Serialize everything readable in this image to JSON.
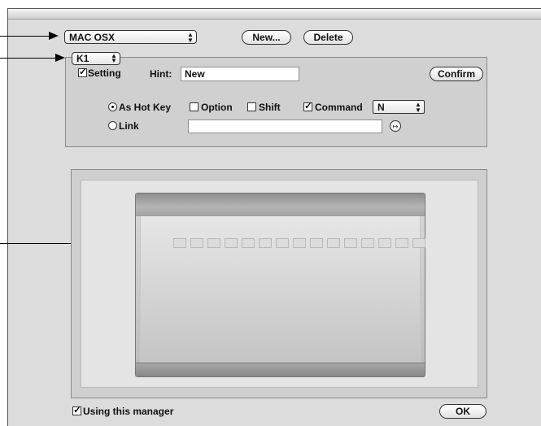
{
  "profile_select": {
    "value": "MAC OSX"
  },
  "toolbar": {
    "new_label": "New...",
    "delete_label": "Delete"
  },
  "key_select": {
    "value": "K1"
  },
  "setting": {
    "label": "Setting",
    "checked": true
  },
  "hint": {
    "label": "Hint:",
    "value": "New"
  },
  "confirm_label": "Confirm",
  "hotkey": {
    "radio_label": "As Hot Key",
    "option_label": "Option",
    "shift_label": "Shift",
    "command_label": "Command",
    "key_value": "N"
  },
  "link": {
    "radio_label": "Link",
    "value": ""
  },
  "using_manager": {
    "label": "Using this manager",
    "checked": true
  },
  "ok_label": "OK",
  "preview": {
    "led_count": 15
  }
}
